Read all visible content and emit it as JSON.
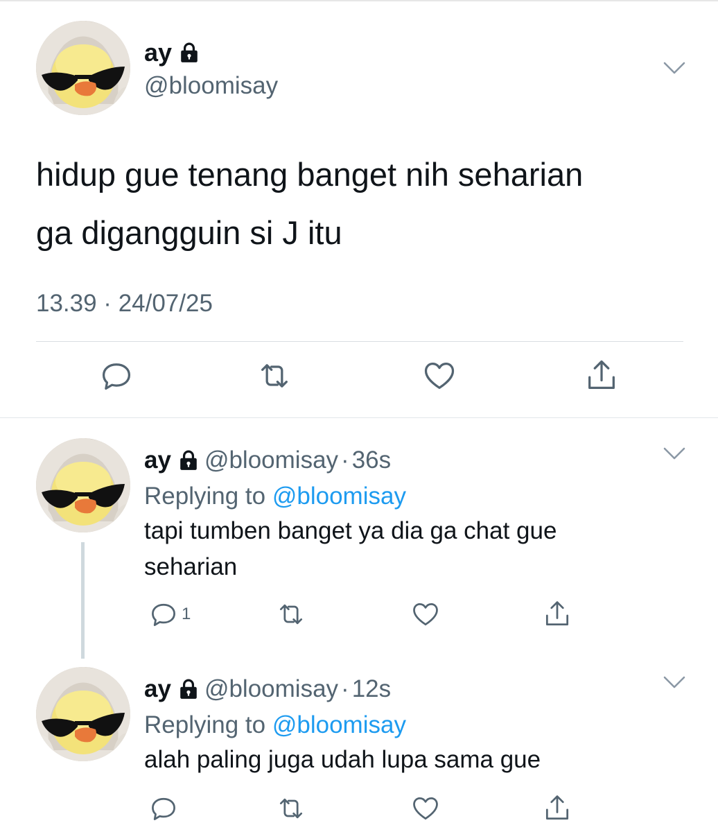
{
  "colors": {
    "text": "#0f1419",
    "secondary": "#536471",
    "link": "#1d9bf0",
    "divider": "#d9dee2"
  },
  "icons": {
    "lock": "lock-icon",
    "chevron": "chevron-down-icon",
    "reply": "reply-icon",
    "retweet": "retweet-icon",
    "like": "heart-icon",
    "share": "share-icon"
  },
  "main_tweet": {
    "name": "ay",
    "handle": "@bloomisay",
    "text_lines": [
      "hidup gue tenang banget nih seharian",
      "ga digangguin si J itu"
    ],
    "timestamp": "13.39 · 24/07/25"
  },
  "replies": [
    {
      "name": "ay",
      "handle": "@bloomisay",
      "separator": "·",
      "time": "36s",
      "replying_prefix": "Replying to",
      "replying_to": "@bloomisay",
      "text_lines": [
        "tapi tumben banget ya dia ga chat gue",
        "seharian"
      ],
      "reply_count": "1"
    },
    {
      "name": "ay",
      "handle": "@bloomisay",
      "separator": "·",
      "time": "12s",
      "replying_prefix": "Replying to",
      "replying_to": "@bloomisay",
      "text_lines": [
        "alah paling juga udah lupa sama gue"
      ],
      "reply_count": ""
    }
  ]
}
